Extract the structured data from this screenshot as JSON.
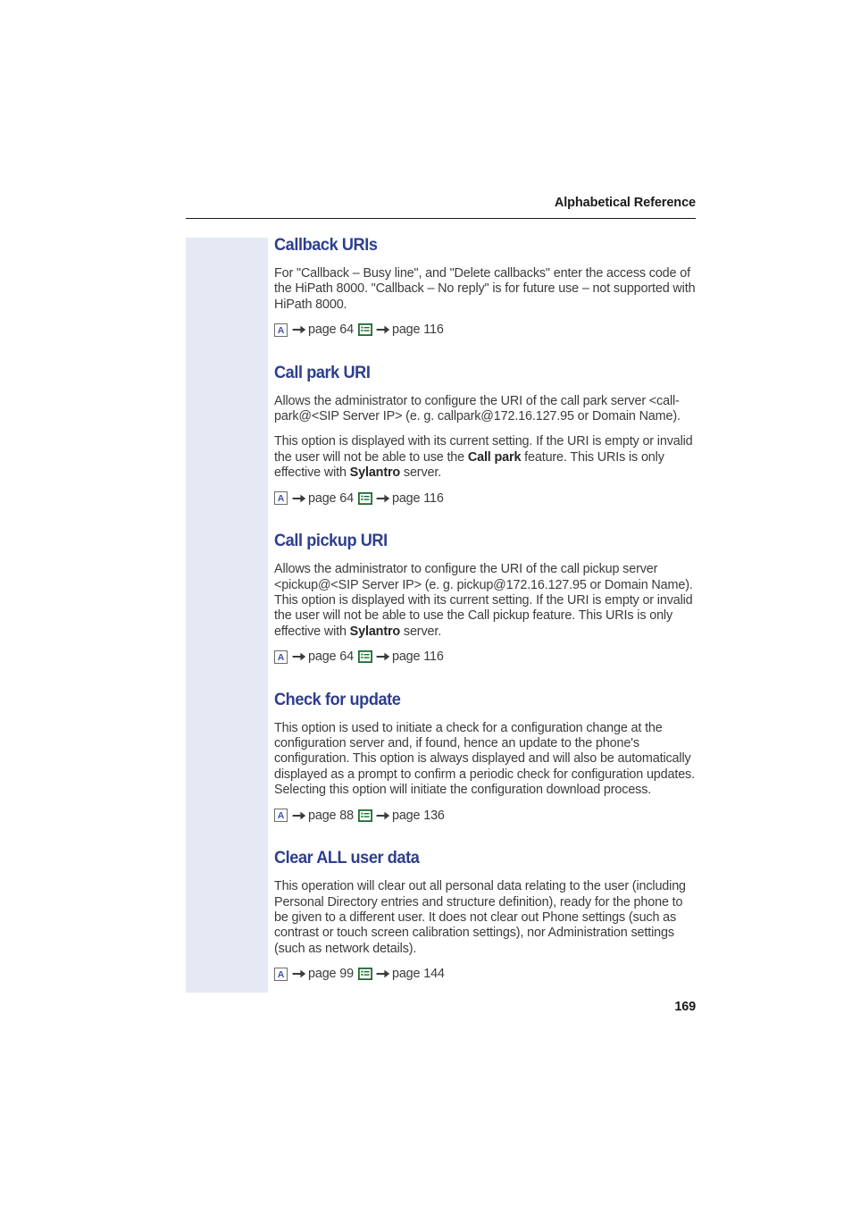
{
  "header": {
    "title": "Alphabetical Reference"
  },
  "icons": {
    "admin": "letter-a-icon",
    "list": "list-menu-icon",
    "arrow": "arrow-right-icon"
  },
  "sections": [
    {
      "heading": "Callback URIs",
      "paragraphs": [
        [
          {
            "text": "For \"Callback – Busy line\", and \"Delete callbacks\" enter the access code of the HiPath 8000. \"Callback – No reply\" is for future use – not supported with HiPath 8000.",
            "bold": false
          }
        ]
      ],
      "reference": {
        "first_label": "page 64",
        "second_label": "page 116"
      }
    },
    {
      "heading": "Call park URI",
      "paragraphs": [
        [
          {
            "text": "Allows the administrator to configure the URI of the call park server <call-park@<SIP Server IP> (e. g. callpark@172.16.127.95 or Domain Name).",
            "bold": false
          }
        ],
        [
          {
            "text": "This option is displayed with its current setting. If the URI is empty or invalid the user will not be able to use the ",
            "bold": false
          },
          {
            "text": "Call park",
            "bold": true
          },
          {
            "text": " feature. This URIs is only effective with ",
            "bold": false
          },
          {
            "text": "Sylantro",
            "bold": true
          },
          {
            "text": " server.",
            "bold": false
          }
        ]
      ],
      "reference": {
        "first_label": "page 64",
        "second_label": "page 116"
      }
    },
    {
      "heading": "Call pickup URI",
      "paragraphs": [
        [
          {
            "text": "Allows the administrator to configure the URI of the call pickup server <pickup@<SIP Server IP> (e. g. pickup@172.16.127.95 or Domain Name). This option is displayed with its current setting. If the URI is empty or invalid the user will not be able to use the Call pickup feature. This URIs is only effective with ",
            "bold": false
          },
          {
            "text": "Sylantro",
            "bold": true
          },
          {
            "text": " server.",
            "bold": false
          }
        ]
      ],
      "reference": {
        "first_label": "page 64",
        "second_label": "page 116"
      }
    },
    {
      "heading": "Check for update",
      "paragraphs": [
        [
          {
            "text": "This option is used to initiate a check for a configuration change at the configuration server and, if found, hence an update to the phone's configuration. This option is always displayed and will also be automatically displayed as a prompt to confirm a periodic check for configuration updates. Selecting this option will initiate the configuration download process.",
            "bold": false
          }
        ]
      ],
      "reference": {
        "first_label": "page 88",
        "second_label": "page 136"
      }
    },
    {
      "heading": "Clear ALL user data",
      "paragraphs": [
        [
          {
            "text": "This operation will clear out all personal data relating to the user (including Personal Directory entries and structure definition), ready for the phone to be given to a different user. It does not clear out Phone settings (such as contrast or touch screen calibration settings), nor Administration settings (such as network details).",
            "bold": false
          }
        ]
      ],
      "reference": {
        "first_label": "page 99",
        "second_label": "page 144"
      }
    }
  ],
  "footer": {
    "page_number": "169"
  },
  "colors": {
    "heading": "#2d3e8f",
    "body": "#3b3b3b",
    "margin_band": "#e5e9f3",
    "list_icon": "#1d6b33",
    "letter_icon": "#3f50a8"
  }
}
